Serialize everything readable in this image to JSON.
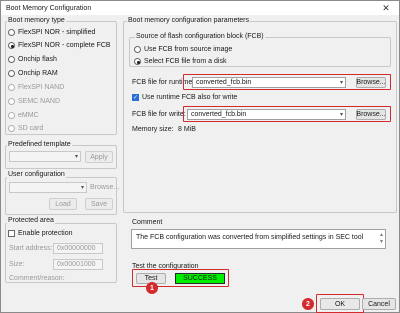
{
  "window": {
    "title": "Boot Memory Configuration",
    "close_glyph": "✕"
  },
  "boot_memory_type": {
    "label": "Boot memory type",
    "options": [
      {
        "label": "FlexSPI NOR - simplified",
        "selected": false,
        "enabled": true
      },
      {
        "label": "FlexSPI NOR - complete FCB",
        "selected": true,
        "enabled": true
      },
      {
        "label": "Onchip flash",
        "selected": false,
        "enabled": true
      },
      {
        "label": "Onchip RAM",
        "selected": false,
        "enabled": true
      },
      {
        "label": "FlexSPI NAND",
        "selected": false,
        "enabled": false
      },
      {
        "label": "SEMC NAND",
        "selected": false,
        "enabled": false
      },
      {
        "label": "eMMC",
        "selected": false,
        "enabled": false
      },
      {
        "label": "SD card",
        "selected": false,
        "enabled": false
      }
    ]
  },
  "predefined_template": {
    "label": "Predefined template",
    "value": "",
    "apply_label": "Apply"
  },
  "user_configuration": {
    "label": "User configuration",
    "value": "",
    "browse_label": "Browse...",
    "load_label": "Load",
    "save_label": "Save"
  },
  "protected_area": {
    "label": "Protected area",
    "enable_label": "Enable protection",
    "enable_checked": false,
    "start_address_label": "Start address:",
    "start_address_value": "0x00000000",
    "size_label": "Size:",
    "size_value": "0x00001000",
    "comment_label": "Comment/reason:"
  },
  "boot_params": {
    "label": "Boot memory configuration parameters",
    "source_group_label": "Source of flash configuration block (FCB)",
    "source_options": [
      {
        "label": "Use FCB from source image",
        "selected": false
      },
      {
        "label": "Select FCB file from a disk",
        "selected": true
      }
    ],
    "runtime_label": "FCB file for runtime:",
    "runtime_value": "converted_fcb.bin",
    "runtime_browse": "Browse...",
    "use_runtime_label": "Use runtime FCB also for write",
    "use_runtime_checked": true,
    "write_label": "FCB file for write:",
    "write_value": "converted_fcb.bin",
    "write_browse": "Browse...",
    "memory_size_label": "Memory size:",
    "memory_size_value": "8 MiB"
  },
  "comment": {
    "label": "Comment",
    "text": "The FCB configuration was converted from simplified settings in SEC tool"
  },
  "test": {
    "label": "Test the configuration",
    "test_button": "Test",
    "status": "SUCCESS",
    "status_color": "#00f000"
  },
  "footer": {
    "ok_label": "OK",
    "cancel_label": "Cancel"
  },
  "annotations": {
    "badge_1": "1",
    "badge_2": "2",
    "highlight_color": "#d32b2b"
  }
}
